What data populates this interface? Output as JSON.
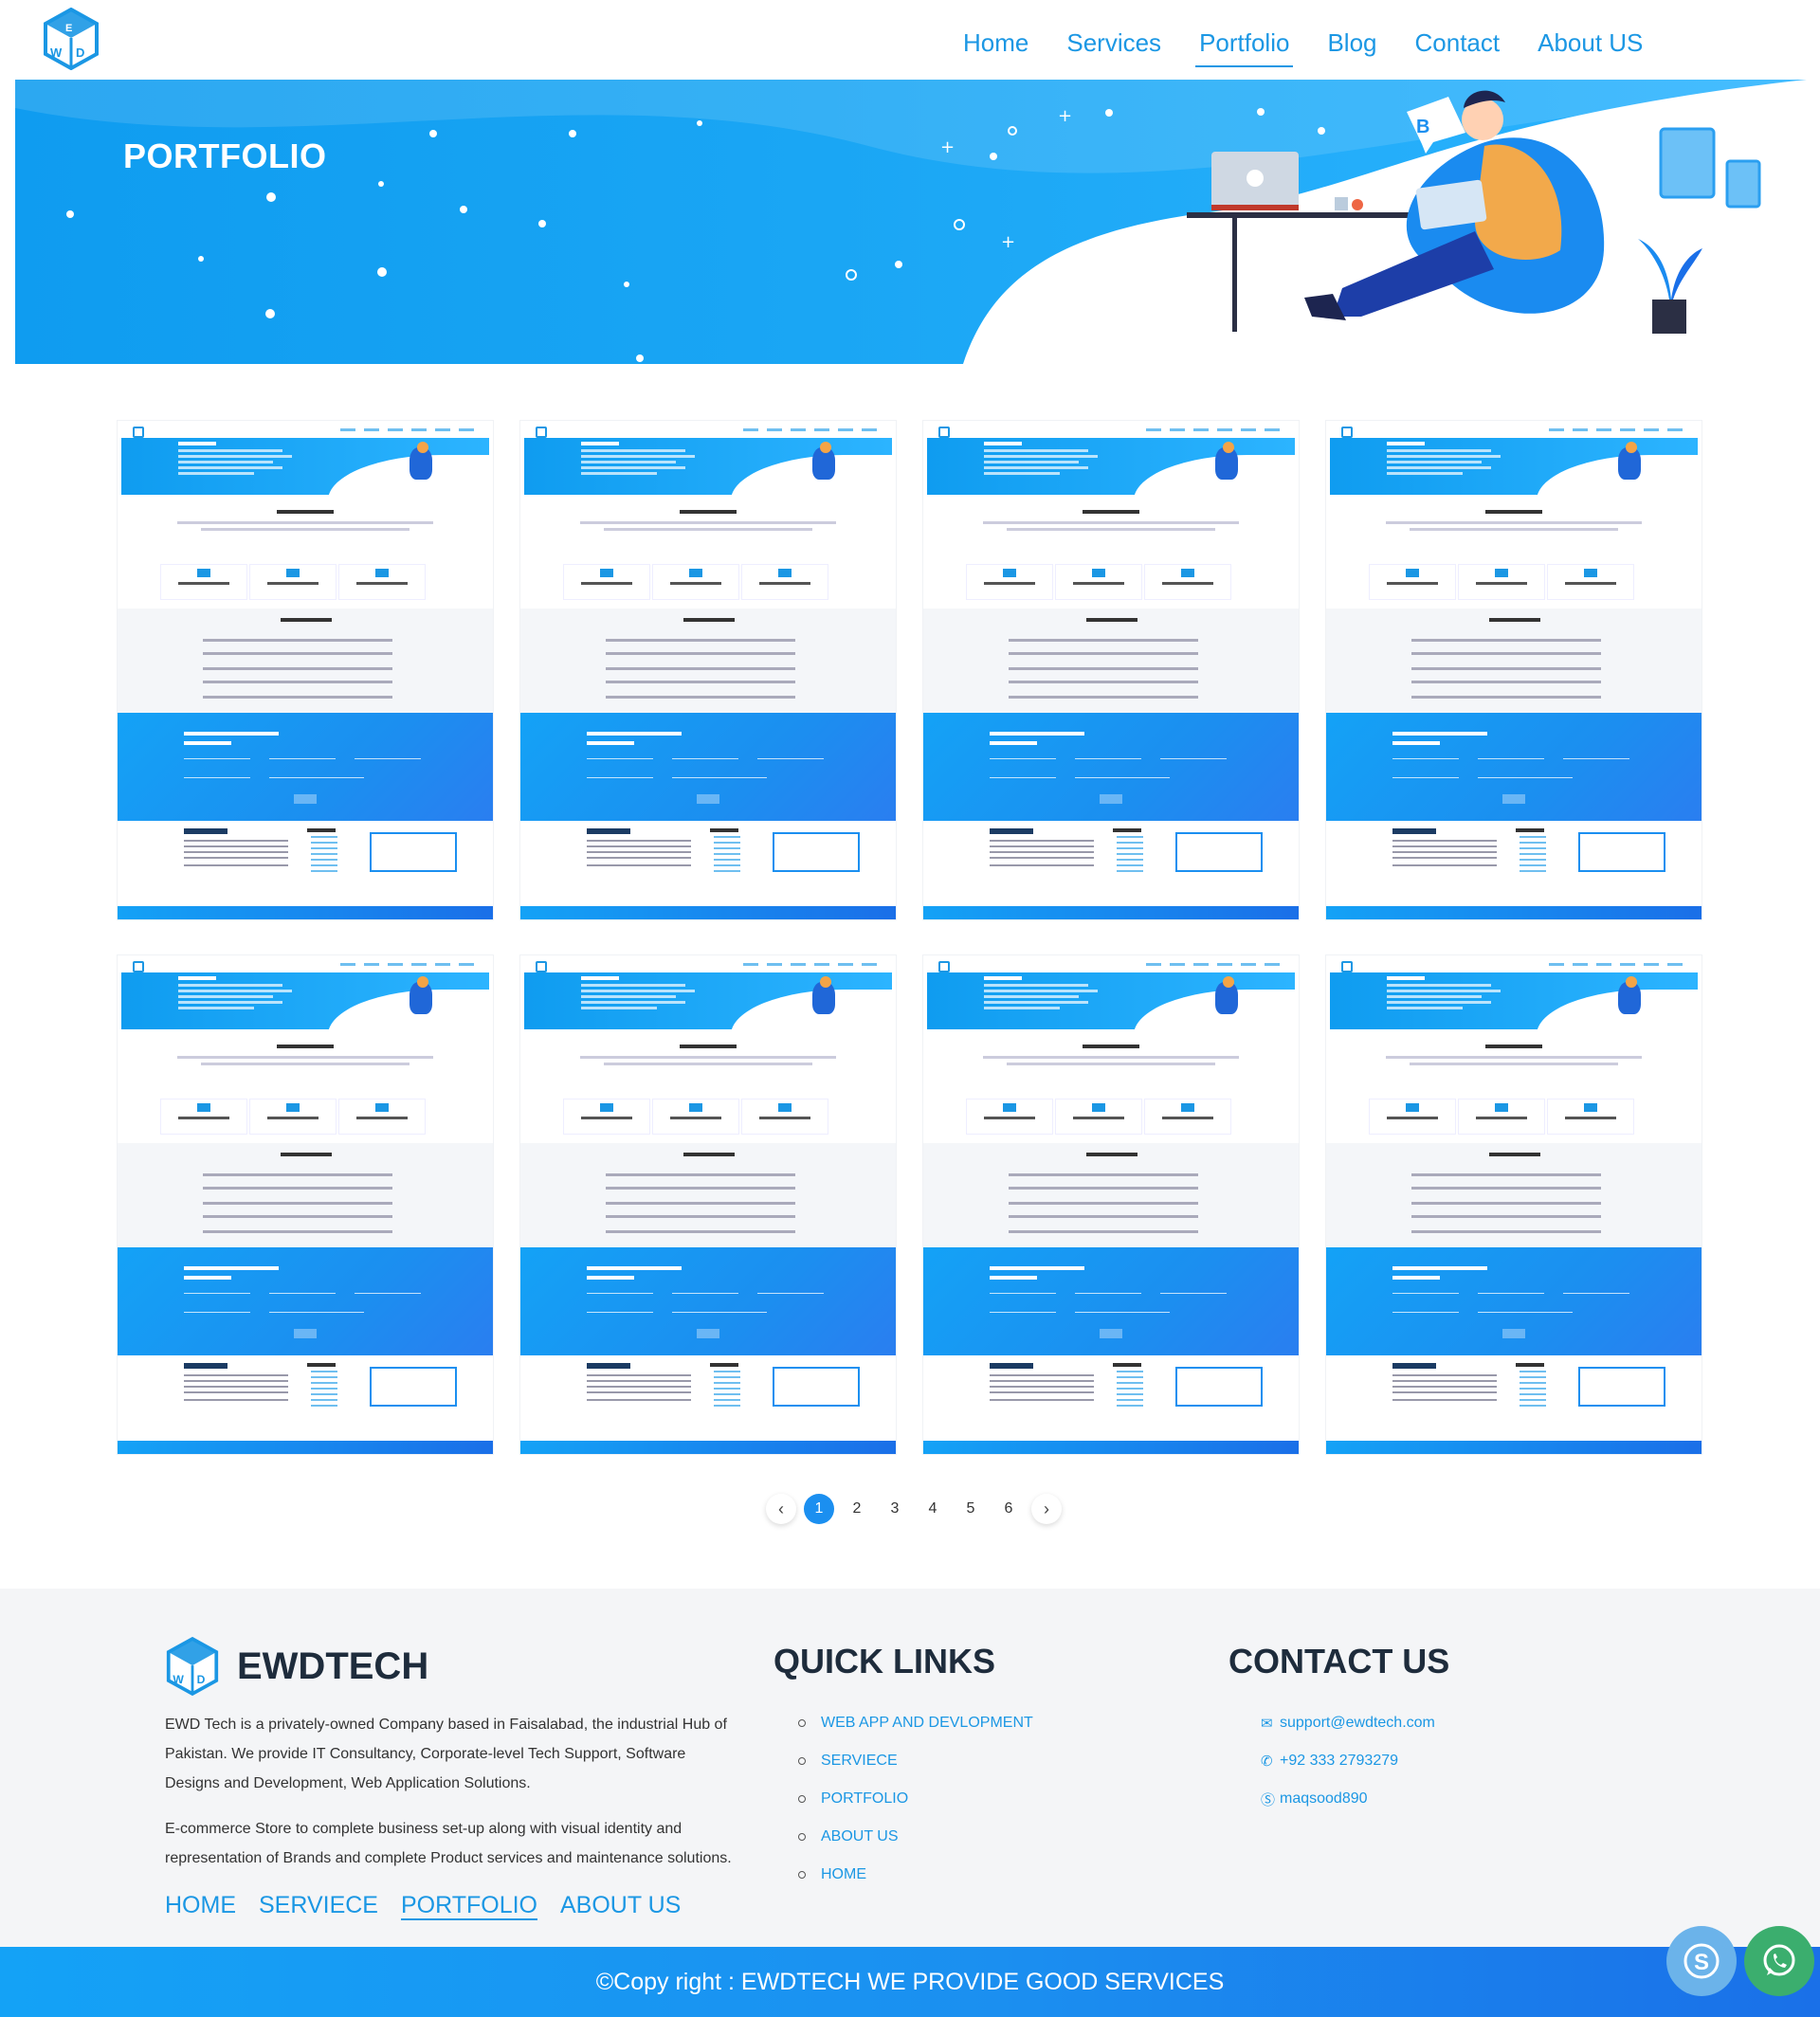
{
  "nav": {
    "items": [
      {
        "label": "Home"
      },
      {
        "label": "Services"
      },
      {
        "label": "Portfolio",
        "active": true
      },
      {
        "label": "Blog"
      },
      {
        "label": "Contact"
      },
      {
        "label": "About US"
      }
    ]
  },
  "hero": {
    "title": "PORTFOLIO"
  },
  "portfolio": {
    "count": 8
  },
  "pagination": {
    "prev": "‹",
    "next": "›",
    "pages": [
      "1",
      "2",
      "3",
      "4",
      "5",
      "6"
    ],
    "current": "1"
  },
  "footer": {
    "brand": "EWDTECH",
    "about_1": "EWD Tech is a privately-owned Company based in Faisalabad, the industrial Hub of Pakistan. We provide IT Consultancy, Corporate-level Tech Support, Software Designs and Development, Web Application Solutions.",
    "about_2": "E-commerce Store to complete business set-up along with visual identity and representation of Brands and complete Product services and maintenance solutions.",
    "links": [
      "HOME",
      "SERVIECE",
      "PORTFOLIO",
      "ABOUT US"
    ],
    "quick_links_title": "QUICK LINKS",
    "quick_links": [
      "WEB APP AND DEVLOPMENT",
      "SERVIECE",
      "PORTFOLIO",
      "ABOUT US",
      "HOME"
    ],
    "contact_title": "CONTACT US",
    "contact": {
      "email": "support@ewdtech.com",
      "phone": "+92 333 2793279",
      "skype": "maqsood890"
    },
    "copyright": "©Copy right : EWDTECH WE PROVIDE GOOD SERVICES"
  },
  "colors": {
    "accent": "#1b97e4",
    "dark": "#1e2c3c",
    "whatsapp": "#3bae6e",
    "skype": "#6bb3ea"
  },
  "icons": [
    "logo-cube-icon",
    "email-icon",
    "phone-icon",
    "skype-icon",
    "whatsapp-icon",
    "chevron-left-icon",
    "chevron-right-icon"
  ]
}
